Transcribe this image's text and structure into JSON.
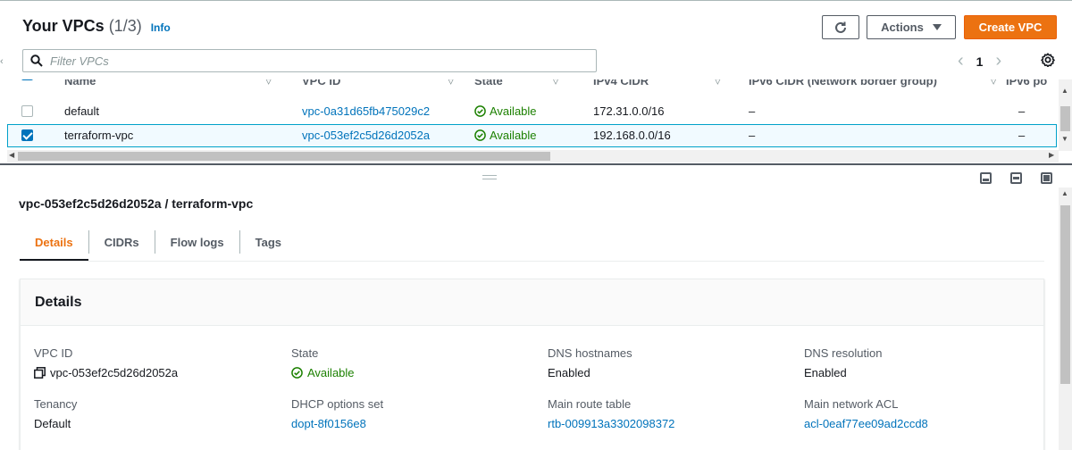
{
  "header": {
    "title": "Your VPCs",
    "count": "(1/3)",
    "info": "Info",
    "actions_label": "Actions",
    "create_label": "Create VPC"
  },
  "filter": {
    "placeholder": "Filter VPCs",
    "value": ""
  },
  "pager": {
    "current": "1"
  },
  "table": {
    "columns": [
      "Name",
      "VPC ID",
      "State",
      "IPv4 CIDR",
      "IPv6 CIDR (Network border group)",
      "IPv6 po"
    ],
    "rows": [
      {
        "name": "default",
        "vpc_id": "vpc-0a31d65fb475029c2",
        "state": "Available",
        "ipv4": "172.31.0.0/16",
        "ipv6": "–",
        "ipv6_pool": "–",
        "selected": false
      },
      {
        "name": "terraform-vpc",
        "vpc_id": "vpc-053ef2c5d26d2052a",
        "state": "Available",
        "ipv4": "192.168.0.0/16",
        "ipv6": "–",
        "ipv6_pool": "–",
        "selected": true
      }
    ]
  },
  "detail": {
    "title": "vpc-053ef2c5d26d2052a / terraform-vpc",
    "tabs": [
      "Details",
      "CIDRs",
      "Flow logs",
      "Tags"
    ],
    "active_tab": "Details",
    "card_title": "Details",
    "fields": {
      "vpc_id": {
        "label": "VPC ID",
        "value": "vpc-053ef2c5d26d2052a"
      },
      "state": {
        "label": "State",
        "value": "Available"
      },
      "dns_hostnames": {
        "label": "DNS hostnames",
        "value": "Enabled"
      },
      "dns_resolution": {
        "label": "DNS resolution",
        "value": "Enabled"
      },
      "tenancy": {
        "label": "Tenancy",
        "value": "Default"
      },
      "dhcp": {
        "label": "DHCP options set",
        "value": "dopt-8f0156e8"
      },
      "route_table": {
        "label": "Main route table",
        "value": "rtb-009913a3302098372"
      },
      "network_acl": {
        "label": "Main network ACL",
        "value": "acl-0eaf77ee09ad2ccd8"
      }
    }
  },
  "colors": {
    "accent": "#ec7211",
    "link": "#0073bb",
    "success": "#1d8102",
    "selected_border": "#00a1c9"
  }
}
